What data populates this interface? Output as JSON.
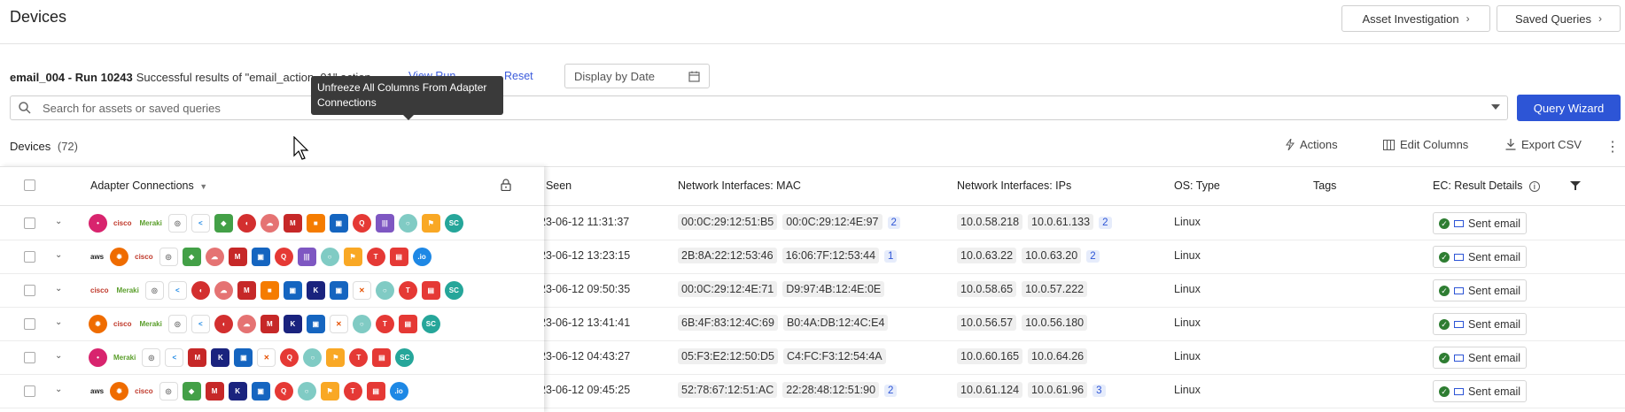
{
  "header": {
    "title": "Devices",
    "asset_investigation": "Asset Investigation",
    "saved_queries": "Saved Queries"
  },
  "run": {
    "title": "email_004 - Run 10243",
    "subtitle": "Successful results of \"email_action_01\" action",
    "view_run": "View Run",
    "reset": "Reset",
    "date_placeholder": "Display by Date"
  },
  "search": {
    "placeholder": "Search for assets or saved queries",
    "query_wizard": "Query Wizard"
  },
  "tooltip": "Unfreeze All Columns From Adapter Connections",
  "toolbar": {
    "devices_label": "Devices",
    "devices_count": "(72)",
    "actions": "Actions",
    "edit_columns": "Edit Columns",
    "export_csv": "Export CSV"
  },
  "columns": {
    "adapter_connections": "Adapter Connections",
    "last_seen": "t Seen",
    "mac": "Network Interfaces: MAC",
    "ips": "Network Interfaces: IPs",
    "os_type": "OS: Type",
    "tags": "Tags",
    "ec_result": "EC: Result Details"
  },
  "colors": {
    "accent": "#2d55d6",
    "success": "#2e7d32",
    "tooltip_bg": "#3a3a3a"
  },
  "rows": [
    {
      "adapters": [
        "nexthink-icon",
        "cisco-icon",
        "cisco-meraki-icon",
        "claroty-icon",
        "vmware-icon",
        "green-shield-icon",
        "redhat-icon",
        "cloud-icon",
        "mcafee-icon",
        "orange-square-icon",
        "blue-box-icon",
        "qualys-icon",
        "purple-bars-icon",
        "circle-icon",
        "yellow-flag-icon",
        "sc-icon"
      ],
      "last_seen": "23-06-12 11:31:37",
      "macs": [
        "00:0C:29:12:51:B5",
        "00:0C:29:12:4E:97"
      ],
      "mac_more": "2",
      "ips": [
        "10.0.58.218",
        "10.0.61.133"
      ],
      "ip_more": "2",
      "os": "Linux",
      "result": "Sent email"
    },
    {
      "adapters": [
        "aws-icon",
        "orange-sun-icon",
        "cisco-icon",
        "claroty-icon",
        "green-shield-icon",
        "cloud-icon",
        "mcafee-icon",
        "blue-box-icon",
        "qualys-icon",
        "purple-bars-icon",
        "circle-icon",
        "yellow-flag-icon",
        "red-circle-icon",
        "red-square-icon",
        "io-icon"
      ],
      "last_seen": "23-06-12 13:23:15",
      "macs": [
        "2B:8A:22:12:53:46",
        "16:06:7F:12:53:44"
      ],
      "mac_more": "1",
      "ips": [
        "10.0.63.22",
        "10.0.63.20"
      ],
      "ip_more": "2",
      "os": "Linux",
      "result": "Sent email"
    },
    {
      "adapters": [
        "cisco-icon",
        "cisco-meraki-icon",
        "claroty-icon",
        "vmware-icon",
        "redhat-icon",
        "cloud-icon",
        "mcafee-icon",
        "orange-square-icon",
        "blue-box-icon",
        "k-shield-icon",
        "blue-box-icon",
        "paloalto-icon",
        "circle-icon",
        "red-circle-icon",
        "red-square-icon",
        "sc-icon"
      ],
      "last_seen": "23-06-12 09:50:35",
      "macs": [
        "00:0C:29:12:4E:71",
        "D9:97:4B:12:4E:0E"
      ],
      "mac_more": "",
      "ips": [
        "10.0.58.65",
        "10.0.57.222"
      ],
      "ip_more": "",
      "os": "Linux",
      "result": "Sent email"
    },
    {
      "adapters": [
        "orange-sun-icon",
        "cisco-icon",
        "cisco-meraki-icon",
        "claroty-icon",
        "vmware-icon",
        "redhat-icon",
        "cloud-icon",
        "mcafee-icon",
        "k-shield-icon",
        "blue-box-icon",
        "paloalto-icon",
        "circle-icon",
        "red-circle-icon",
        "red-square-icon",
        "sc-icon"
      ],
      "last_seen": "23-06-12 13:41:41",
      "macs": [
        "6B:4F:83:12:4C:69",
        "B0:4A:DB:12:4C:E4"
      ],
      "mac_more": "",
      "ips": [
        "10.0.56.57",
        "10.0.56.180"
      ],
      "ip_more": "",
      "os": "Linux",
      "result": "Sent email"
    },
    {
      "adapters": [
        "nexthink-icon",
        "cisco-meraki-icon",
        "claroty-icon",
        "vmware-icon",
        "mcafee-icon",
        "k-shield-icon",
        "blue-box-icon",
        "paloalto-icon",
        "qualys-icon",
        "circle-icon",
        "yellow-flag-icon",
        "red-circle-icon",
        "red-square-icon",
        "sc-icon"
      ],
      "last_seen": "23-06-12 04:43:27",
      "macs": [
        "05:F3:E2:12:50:D5",
        "C4:FC:F3:12:54:4A"
      ],
      "mac_more": "",
      "ips": [
        "10.0.60.165",
        "10.0.64.26"
      ],
      "ip_more": "",
      "os": "Linux",
      "result": "Sent email"
    },
    {
      "adapters": [
        "aws-icon",
        "orange-sun-icon",
        "cisco-icon",
        "claroty-icon",
        "green-shield-icon",
        "mcafee-icon",
        "k-shield-icon",
        "blue-box-icon",
        "qualys-icon",
        "circle-icon",
        "yellow-flag-icon",
        "red-circle-icon",
        "red-square-icon",
        "io-icon"
      ],
      "last_seen": "23-06-12 09:45:25",
      "macs": [
        "52:78:67:12:51:AC",
        "22:28:48:12:51:90"
      ],
      "mac_more": "2",
      "ips": [
        "10.0.61.124",
        "10.0.61.96"
      ],
      "ip_more": "3",
      "os": "Linux",
      "result": "Sent email"
    }
  ]
}
